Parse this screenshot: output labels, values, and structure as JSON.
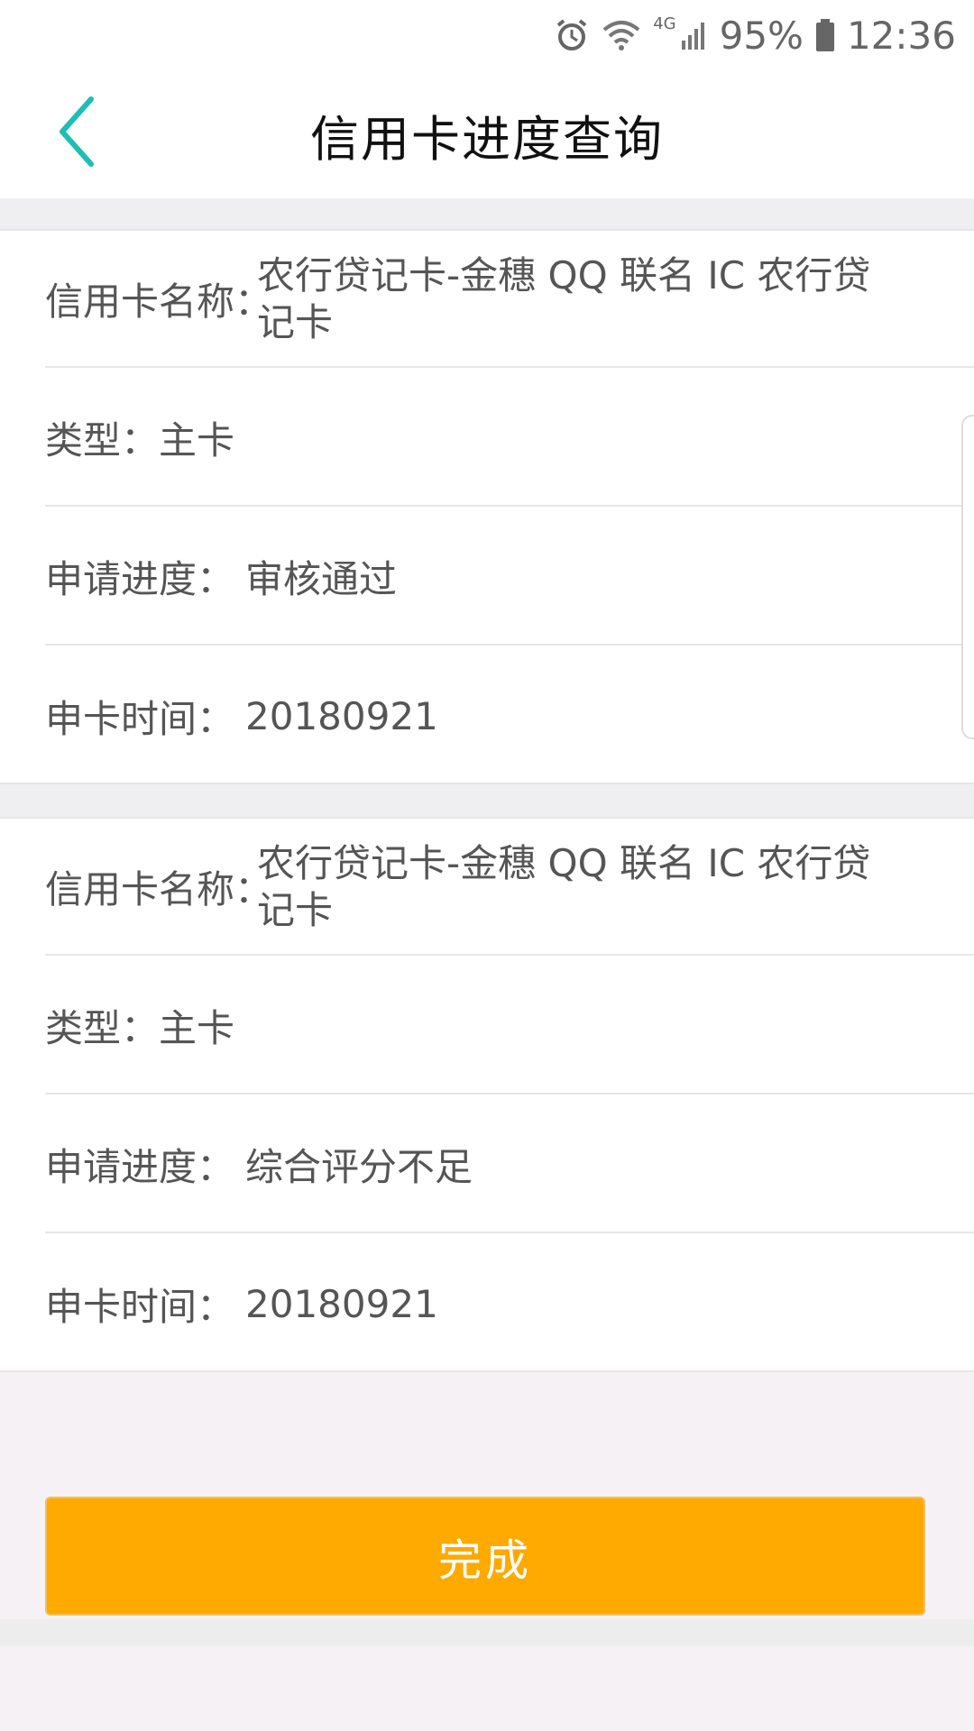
{
  "status_bar": {
    "battery": "95%",
    "time": "12:36",
    "network": "4G"
  },
  "nav": {
    "title": "信用卡进度查询"
  },
  "records": [
    {
      "name_label": "信用卡名称：",
      "name_value": "农行贷记卡-金穗 QQ 联名 IC 农行贷记卡",
      "type_text": "类型：主卡",
      "progress_label": "申请进度：",
      "progress_value": "审核通过",
      "time_label": "申卡时间：",
      "time_value": "20180921"
    },
    {
      "name_label": "信用卡名称：",
      "name_value": "农行贷记卡-金穗 QQ 联名 IC 农行贷记卡",
      "type_text": "类型：主卡",
      "progress_label": "申请进度：",
      "progress_value": "综合评分不足",
      "time_label": "申卡时间：",
      "time_value": "20180921"
    }
  ],
  "done_button": {
    "label": "完成"
  },
  "colors": {
    "accent": "#1bbfb5",
    "button": "#ffaa00"
  }
}
